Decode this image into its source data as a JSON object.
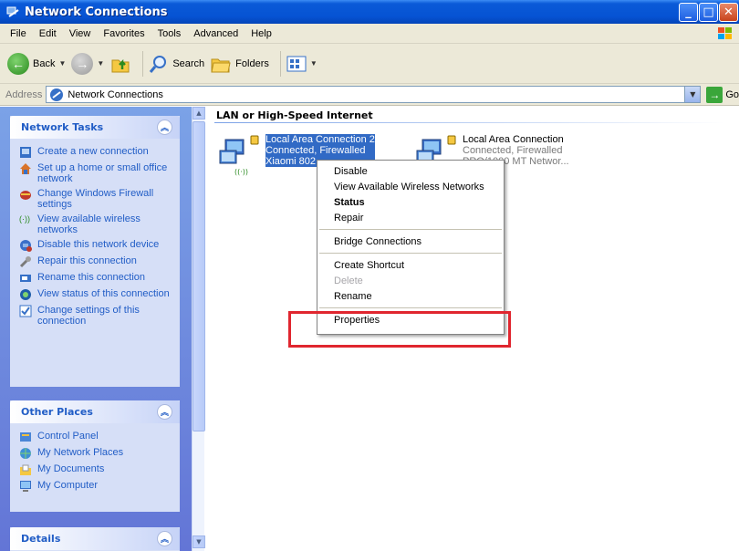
{
  "window": {
    "title": "Network Connections"
  },
  "menubar": {
    "items": [
      "File",
      "Edit",
      "View",
      "Favorites",
      "Tools",
      "Advanced",
      "Help"
    ]
  },
  "toolbar": {
    "back_label": "Back",
    "search_label": "Search",
    "folders_label": "Folders"
  },
  "address": {
    "label": "Address",
    "value": "Network Connections",
    "go_label": "Go"
  },
  "network_tasks": {
    "title": "Network Tasks",
    "items": [
      {
        "label": "Create a new connection",
        "icon": "new-connection-icon"
      },
      {
        "label": "Set up a home or small office network",
        "icon": "home-network-icon"
      },
      {
        "label": "Change Windows Firewall settings",
        "icon": "firewall-icon"
      },
      {
        "label": "View available wireless networks",
        "icon": "wireless-icon"
      },
      {
        "label": "Disable this network device",
        "icon": "disable-icon"
      },
      {
        "label": "Repair this connection",
        "icon": "repair-icon"
      },
      {
        "label": "Rename this connection",
        "icon": "rename-icon"
      },
      {
        "label": "View status of this connection",
        "icon": "status-icon"
      },
      {
        "label": "Change settings of this connection",
        "icon": "settings-icon"
      }
    ]
  },
  "other_places": {
    "title": "Other Places",
    "items": [
      {
        "label": "Control Panel",
        "icon": "control-panel-icon"
      },
      {
        "label": "My Network Places",
        "icon": "network-places-icon"
      },
      {
        "label": "My Documents",
        "icon": "documents-icon"
      },
      {
        "label": "My Computer",
        "icon": "computer-icon"
      }
    ]
  },
  "details": {
    "title": "Details"
  },
  "main": {
    "group_title": "LAN or High-Speed Internet",
    "connections": [
      {
        "name": "Local Area Connection 2",
        "status": "Connected, Firewalled",
        "device": "Xiaomi 802",
        "selected": true
      },
      {
        "name": "Local Area Connection",
        "status": "Connected, Firewalled",
        "device": "PRO/1000 MT Networ..."
      }
    ]
  },
  "context_menu": {
    "items": [
      {
        "label": "Disable"
      },
      {
        "label": "View Available Wireless Networks"
      },
      {
        "label": "Status",
        "bold": true
      },
      {
        "label": "Repair"
      },
      {
        "label": "Bridge Connections"
      },
      {
        "label": "Create Shortcut"
      },
      {
        "label": "Delete",
        "disabled": true
      },
      {
        "label": "Rename"
      },
      {
        "label": "Properties"
      }
    ]
  },
  "colors": {
    "highlight": "#e0262f",
    "link": "#215dc6",
    "selection": "#316ac5"
  }
}
